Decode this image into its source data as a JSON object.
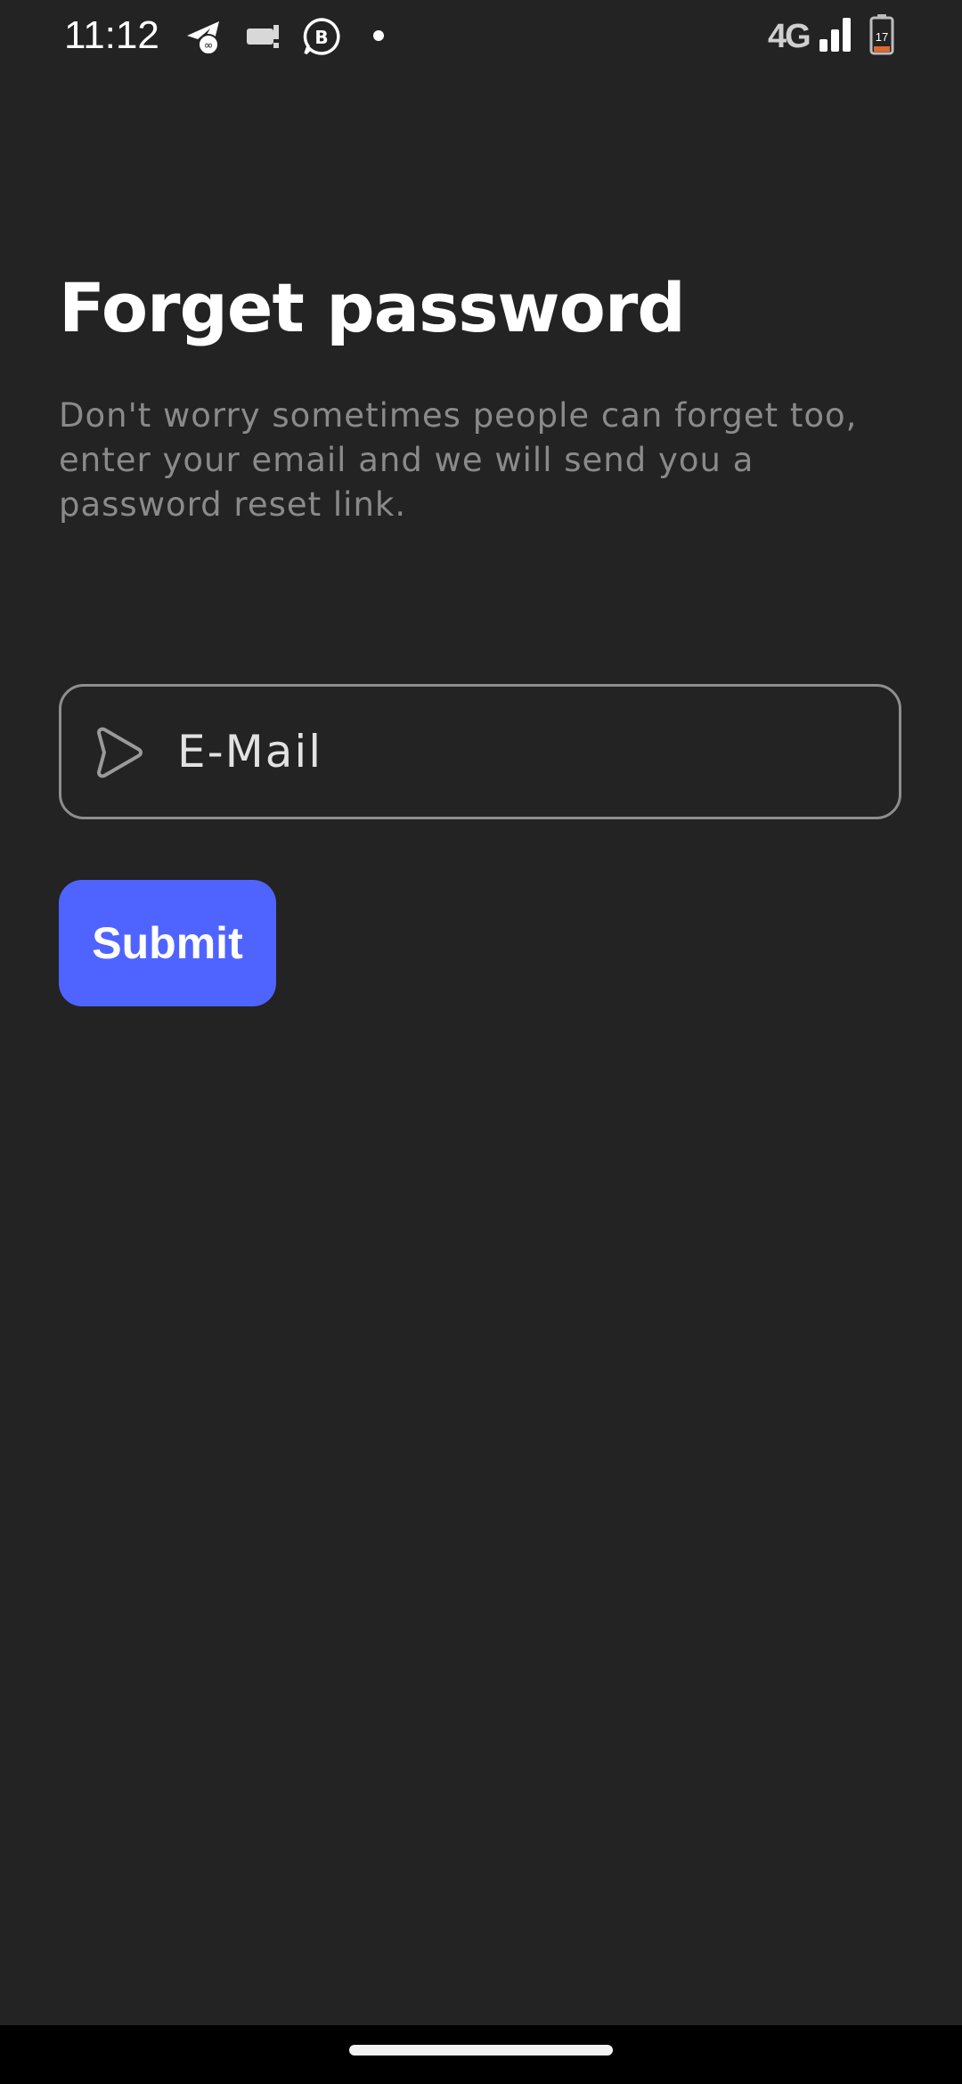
{
  "status_bar": {
    "time": "11:12",
    "network": "4G",
    "battery_level": "17",
    "icons": [
      "telegram-icon",
      "message-alert-icon",
      "whatsapp-business-icon",
      "notification-dot-icon",
      "signal-icon",
      "battery-icon"
    ]
  },
  "screen": {
    "title": "Forget password",
    "subtitle": "Don't worry sometimes people can forget too, enter your email and we will send you a password reset link."
  },
  "email_field": {
    "placeholder": "E-Mail",
    "icon": "send-icon"
  },
  "submit_button": {
    "label": "Submit"
  },
  "colors": {
    "background": "#232323",
    "accent": "#4f64ff",
    "subtitle_text": "#8a8a8a",
    "field_border": "#8e8e8e"
  }
}
